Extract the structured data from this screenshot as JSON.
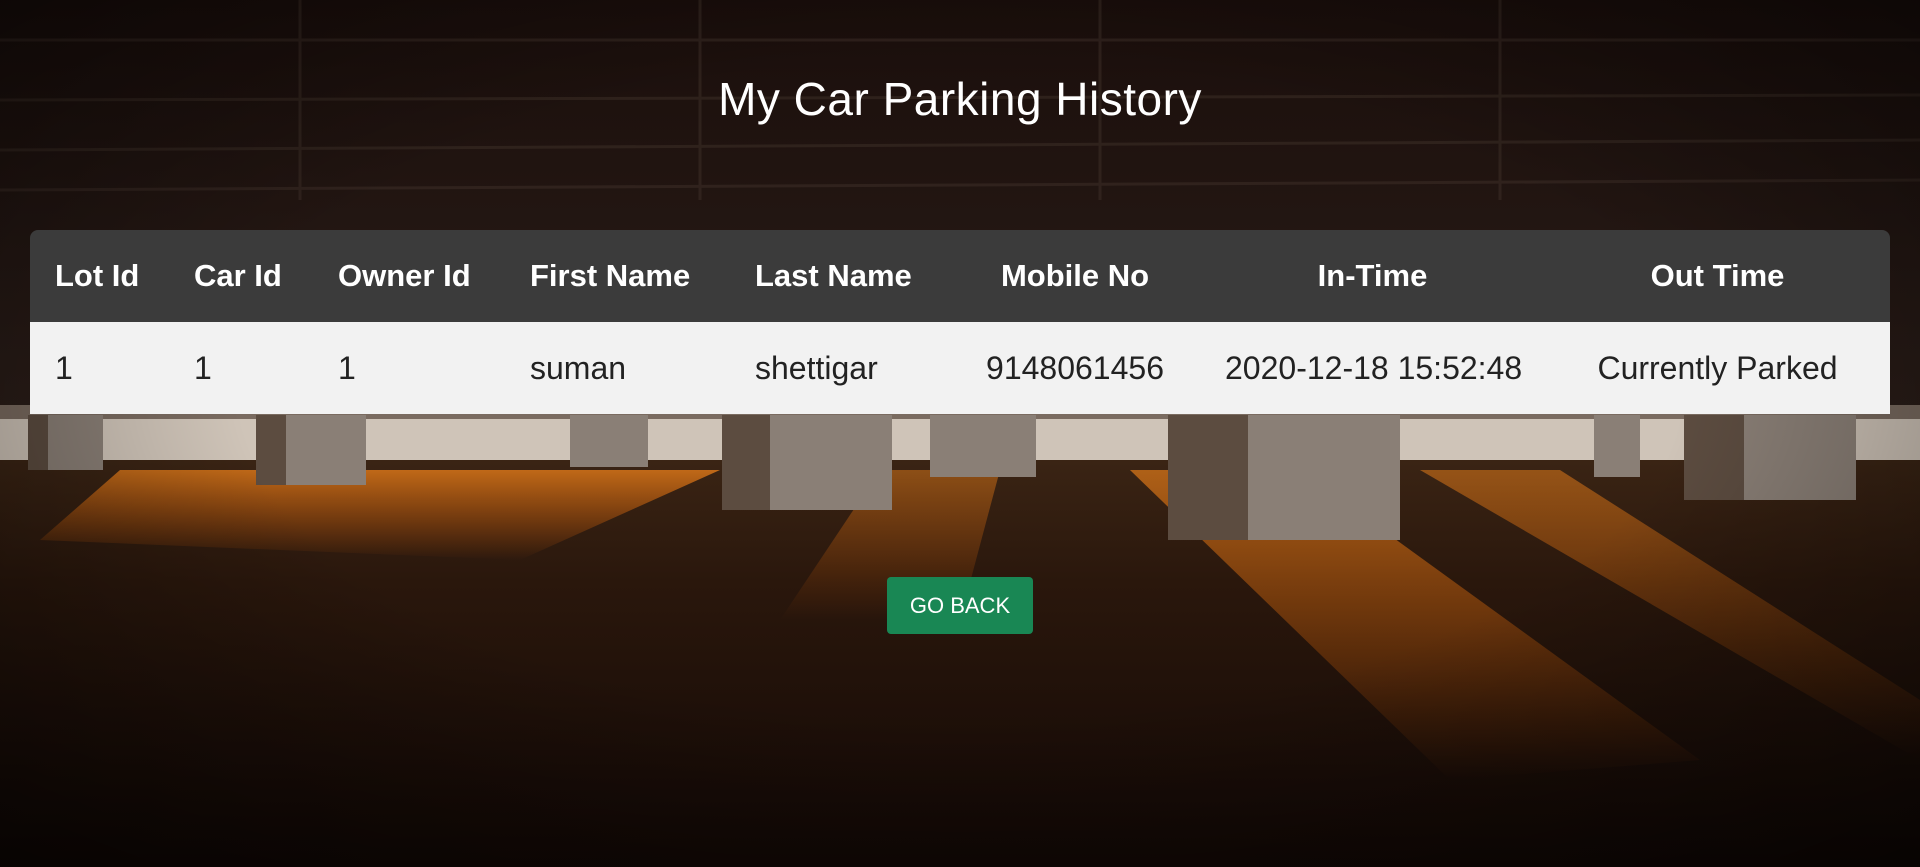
{
  "page": {
    "title": "My Car Parking History"
  },
  "table": {
    "headers": [
      "Lot Id",
      "Car Id",
      "Owner Id",
      "First Name",
      "Last Name",
      "Mobile No",
      "In-Time",
      "Out Time"
    ],
    "rows": [
      [
        "1",
        "1",
        "1",
        "suman",
        "shettigar",
        "9148061456",
        "2020-12-18 15:52:48",
        "Currently Parked"
      ]
    ]
  },
  "actions": {
    "go_back_label": "GO BACK"
  },
  "colors": {
    "header_bg": "#3b3b3b",
    "row_bg": "#f2f2f2",
    "button_bg": "#198754"
  }
}
